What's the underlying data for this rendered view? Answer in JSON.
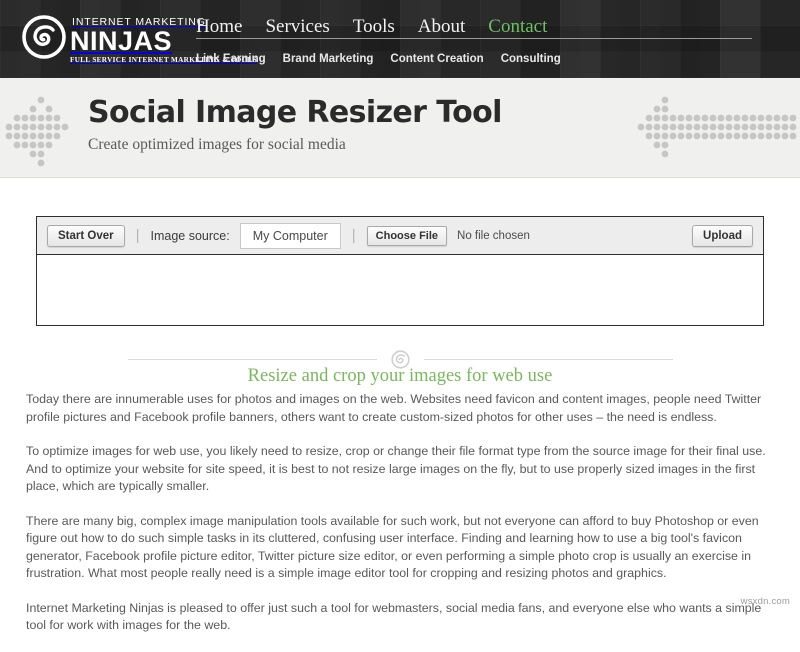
{
  "header": {
    "logo": {
      "mark": "ninja-spiral-icon",
      "line1": "INTERNET MARKETING",
      "line2": "NINJAS",
      "line3": "FULL SERVICE INTERNET MARKETING & TOOLS"
    },
    "nav_main": [
      {
        "label": "Home",
        "accent": false
      },
      {
        "label": "Services",
        "accent": false
      },
      {
        "label": "Tools",
        "accent": false
      },
      {
        "label": "About",
        "accent": false
      },
      {
        "label": "Contact",
        "accent": true
      }
    ],
    "nav_sub": [
      {
        "label": "Link Earning"
      },
      {
        "label": "Brand Marketing"
      },
      {
        "label": "Content Creation"
      },
      {
        "label": "Consulting"
      }
    ],
    "accent_color": "#6cbf63"
  },
  "banner": {
    "title": "Social Image Resizer Tool",
    "subtitle": "Create optimized images for social media",
    "decoration_left": "dot-arrow-icon",
    "decoration_right": "dot-arrow-icon"
  },
  "toolbar": {
    "start_over_label": "Start Over",
    "image_source_label": "Image source:",
    "image_source_value": "My Computer",
    "choose_file_label": "Choose File",
    "file_status": "No file chosen",
    "upload_label": "Upload",
    "separator": "|"
  },
  "divider": {
    "icon": "ninja-spiral-icon"
  },
  "content": {
    "heading": "Resize and crop your images for web use",
    "heading_color": "#7ab85c",
    "paragraphs": [
      "Today there are innumerable uses for photos and images on the web. Websites need favicon and content images, people need Twitter profile pictures and Facebook profile banners, others want to create custom-sized photos for other uses – the need is endless.",
      "To optimize images for web use, you likely need to resize, crop or change their file format type from the source image for their final use. And to optimize your website for site speed, it is best to not resize large images on the fly, but to use properly sized images in the first place, which are typically smaller.",
      "There are many big, complex image manipulation tools available for such work, but not everyone can afford to buy Photoshop or even figure out how to do such simple tasks in its cluttered, confusing user interface. Finding and learning how to use a big tool's favicon generator, Facebook profile picture editor, Twitter picture size editor, or even performing a simple photo crop is usually an exercise in frustration. What most people really need is a simple image editor tool for cropping and resizing photos and graphics.",
      "Internet Marketing Ninjas is pleased to offer just such a tool for webmasters, social media fans, and everyone else who wants a simple tool for work with images for the web."
    ]
  },
  "watermark": {
    "text": "wsxdn.com"
  }
}
